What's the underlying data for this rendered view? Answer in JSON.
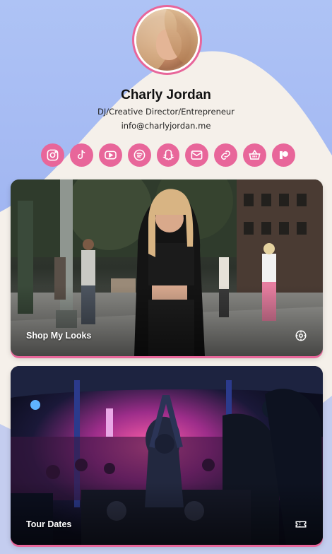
{
  "profile": {
    "name": "Charly Jordan",
    "subtitle": "DJ/Creative Director/Entrepreneur",
    "email": "info@charlyjordan.me"
  },
  "socials": [
    {
      "icon": "instagram-icon"
    },
    {
      "icon": "tiktok-icon"
    },
    {
      "icon": "youtube-icon"
    },
    {
      "icon": "spotify-icon"
    },
    {
      "icon": "snapchat-icon"
    },
    {
      "icon": "email-icon"
    },
    {
      "icon": "link-icon"
    },
    {
      "icon": "shop-basket-icon"
    },
    {
      "icon": "patreon-icon"
    }
  ],
  "cards": [
    {
      "label": "Shop My Looks",
      "icon": "shop-target-icon"
    },
    {
      "label": "Tour Dates",
      "icon": "ticket-icon"
    }
  ],
  "colors": {
    "accent": "#e8669a",
    "background_top": "#aec3f5",
    "background_bottom": "#8fa2ee",
    "blob": "#f5f0ea"
  }
}
